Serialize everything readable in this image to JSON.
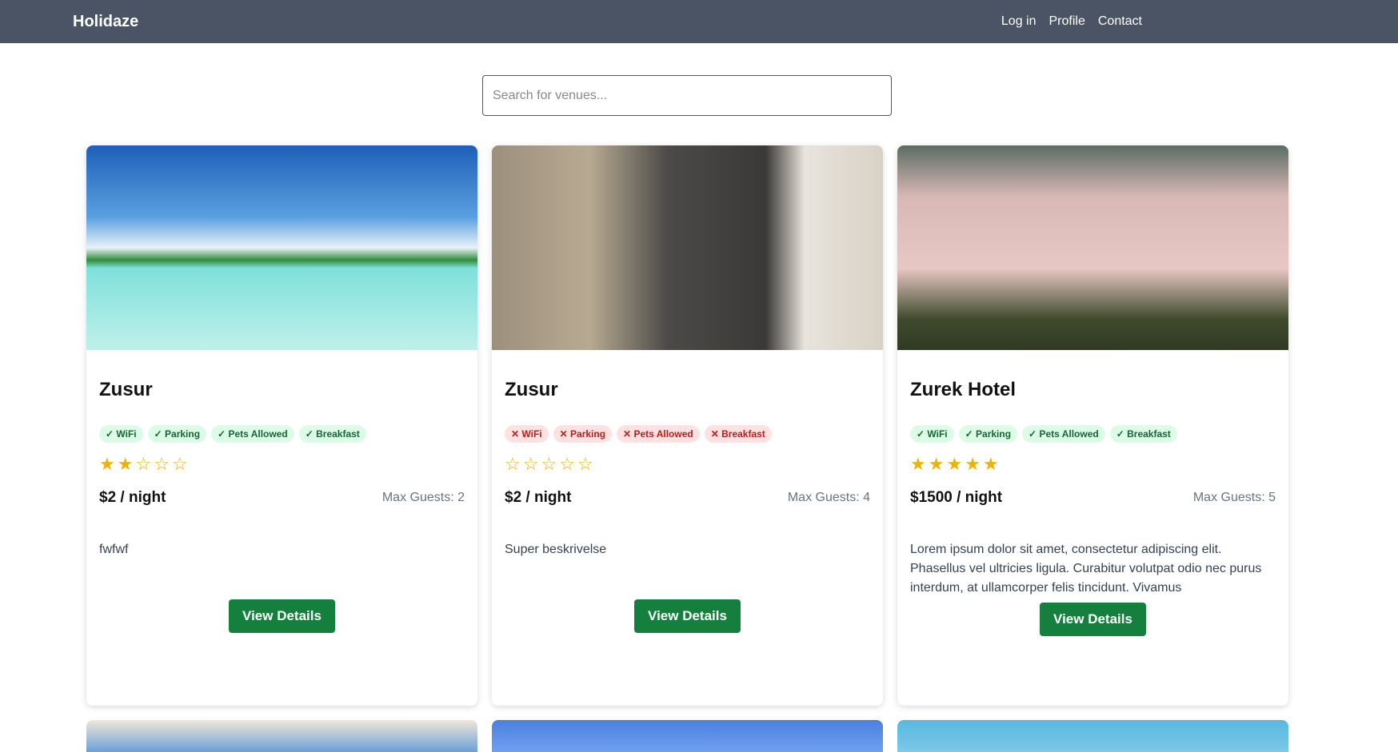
{
  "nav": {
    "brand": "Holidaze",
    "links": [
      "Log in",
      "Profile",
      "Contact"
    ]
  },
  "search": {
    "placeholder": "Search for venues...",
    "value": ""
  },
  "venues": [
    {
      "name": "Zusur",
      "amenities": [
        {
          "label": "WiFi",
          "ok": true
        },
        {
          "label": "Parking",
          "ok": true
        },
        {
          "label": "Pets Allowed",
          "ok": true
        },
        {
          "label": "Breakfast",
          "ok": true
        }
      ],
      "rating": 2,
      "price": "$2 / night",
      "guests": "Max Guests: 2",
      "description": "fwfwf",
      "button": "View Details"
    },
    {
      "name": "Zusur",
      "amenities": [
        {
          "label": "WiFi",
          "ok": false
        },
        {
          "label": "Parking",
          "ok": false
        },
        {
          "label": "Pets Allowed",
          "ok": false
        },
        {
          "label": "Breakfast",
          "ok": false
        }
      ],
      "rating": 0,
      "price": "$2 / night",
      "guests": "Max Guests: 4",
      "description": "Super beskrivelse",
      "button": "View Details"
    },
    {
      "name": "Zurek Hotel",
      "amenities": [
        {
          "label": "WiFi",
          "ok": true
        },
        {
          "label": "Parking",
          "ok": true
        },
        {
          "label": "Pets Allowed",
          "ok": true
        },
        {
          "label": "Breakfast",
          "ok": true
        }
      ],
      "rating": 5,
      "price": "$1500 / night",
      "guests": "Max Guests: 5",
      "description": "Lorem ipsum dolor sit amet, consectetur adipiscing elit. Phasellus vel ultricies ligula. Curabitur volutpat odio nec purus interdum, at ullamcorper felis tincidunt. Vivamus",
      "button": "View Details"
    }
  ]
}
